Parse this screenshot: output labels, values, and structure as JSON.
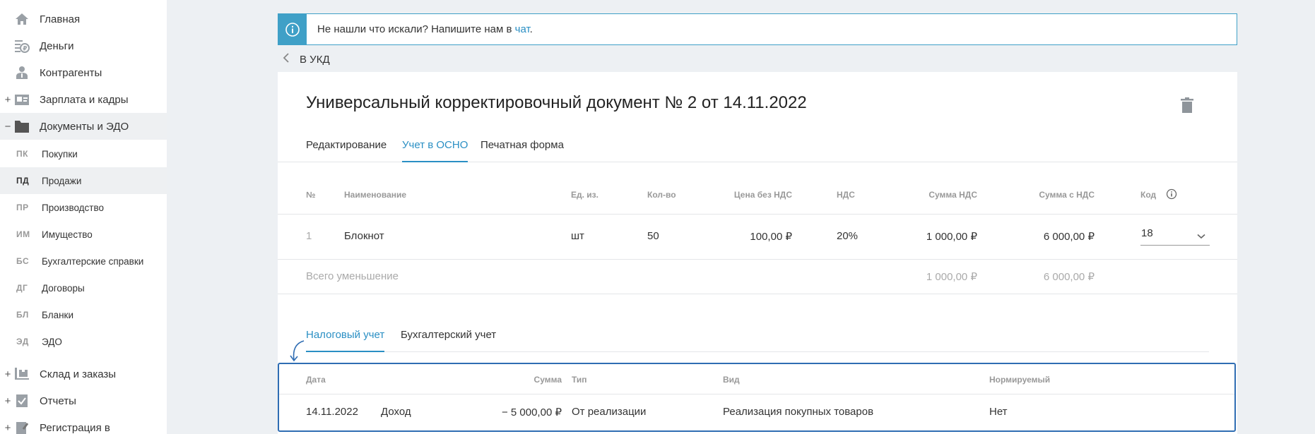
{
  "sidebar": {
    "items": [
      {
        "label": "Главная",
        "icon": "home-icon",
        "expander": ""
      },
      {
        "label": "Деньги",
        "icon": "money-icon",
        "expander": ""
      },
      {
        "label": "Контрагенты",
        "icon": "contractors-icon",
        "expander": ""
      },
      {
        "label": "Зарплата и кадры",
        "icon": "salary-icon",
        "expander": "+"
      },
      {
        "label": "Документы и ЭДО",
        "icon": "folder-icon",
        "expander": "−"
      }
    ],
    "subitems": [
      {
        "abbr": "ПК",
        "label": "Покупки"
      },
      {
        "abbr": "ПД",
        "label": "Продажи"
      },
      {
        "abbr": "ПР",
        "label": "Производство"
      },
      {
        "abbr": "ИМ",
        "label": "Имущество"
      },
      {
        "abbr": "БС",
        "label": "Бухгалтерские справки"
      },
      {
        "abbr": "ДГ",
        "label": "Договоры"
      },
      {
        "abbr": "БЛ",
        "label": "Бланки"
      },
      {
        "abbr": "ЭД",
        "label": "ЭДО"
      }
    ],
    "items2": [
      {
        "label": "Склад и заказы",
        "icon": "warehouse-icon",
        "expander": "+"
      },
      {
        "label": "Отчеты",
        "icon": "reports-icon",
        "expander": "+"
      },
      {
        "label": "Регистрация в",
        "icon": "registration-icon",
        "expander": "+"
      }
    ]
  },
  "banner": {
    "text": "Не нашли что искали? Напишите нам в ",
    "link": "чат",
    "tail": "."
  },
  "back": {
    "label": "В УКД"
  },
  "document": {
    "title": "Универсальный корректировочный документ № 2 от 14.11.2022"
  },
  "tabs": [
    "Редактирование",
    "Учет в ОСНО",
    "Печатная форма"
  ],
  "table": {
    "headers": [
      "№",
      "Наименование",
      "Ед. из.",
      "Кол-во",
      "Цена без НДС",
      "НДС",
      "Сумма НДС",
      "Сумма с НДС",
      "Код"
    ],
    "rows": [
      {
        "num": "1",
        "name": "Блокнот",
        "unit": "шт",
        "qty": "50",
        "price": "100,00 ₽",
        "vat": "20%",
        "vat_sum": "1 000,00 ₽",
        "total": "6 000,00 ₽",
        "code": "18"
      }
    ],
    "footer": {
      "label": "Всего уменьшение",
      "vat_sum": "1 000,00 ₽",
      "total": "6 000,00 ₽"
    }
  },
  "tabs2": [
    "Налоговый учет",
    "Бухгалтерский учет"
  ],
  "tax": {
    "headers": [
      "Дата",
      "Сумма",
      "Тип",
      "Вид",
      "Нормируемый"
    ],
    "rows": [
      {
        "date": "14.11.2022",
        "direction": "Доход",
        "sum": "− 5 000,00 ₽",
        "type": "От реализации",
        "kind": "Реализация покупных товаров",
        "normalized": "Нет"
      }
    ]
  },
  "colors": {
    "accent": "#2a8fc4",
    "highlight_border": "#2f6db3",
    "banner": "#3fa0c7"
  }
}
